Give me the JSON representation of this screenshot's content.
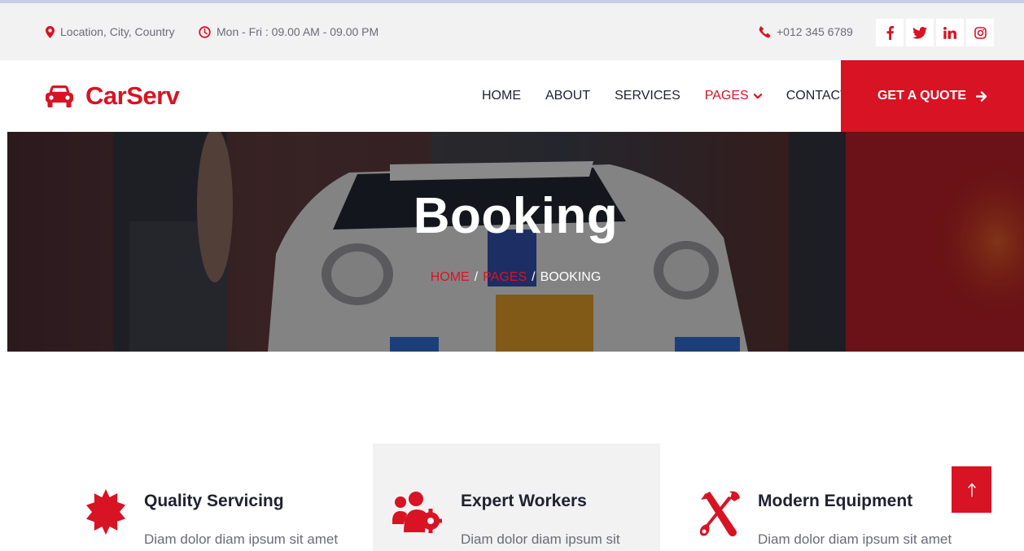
{
  "topbar": {
    "location": "Location, City, Country",
    "hours": "Mon - Fri : 09.00 AM - 09.00 PM",
    "phone": "+012 345 6789",
    "socials": [
      "facebook-icon",
      "twitter-icon",
      "linkedin-icon",
      "instagram-icon"
    ]
  },
  "navbar": {
    "brand": "CarServ",
    "links": [
      "HOME",
      "ABOUT",
      "SERVICES",
      "PAGES",
      "CONTACT"
    ],
    "active_link": "PAGES",
    "cta": "GET A QUOTE"
  },
  "hero": {
    "title": "Booking",
    "breadcrumb": [
      "HOME",
      "PAGES",
      "BOOKING"
    ],
    "separator": "/"
  },
  "features": [
    {
      "icon": "certificate-icon",
      "title": "Quality Servicing",
      "desc": "Diam dolor diam ipsum sit amet"
    },
    {
      "icon": "users-cog-icon",
      "title": "Expert Workers",
      "desc": "Diam dolor diam ipsum sit"
    },
    {
      "icon": "tools-icon",
      "title": "Modern Equipment",
      "desc": "Diam dolor diam ipsum sit amet"
    }
  ],
  "colors": {
    "primary": "#d81324",
    "dark": "#1f2133",
    "light": "#f2f2f3",
    "text": "#6b6b78"
  }
}
